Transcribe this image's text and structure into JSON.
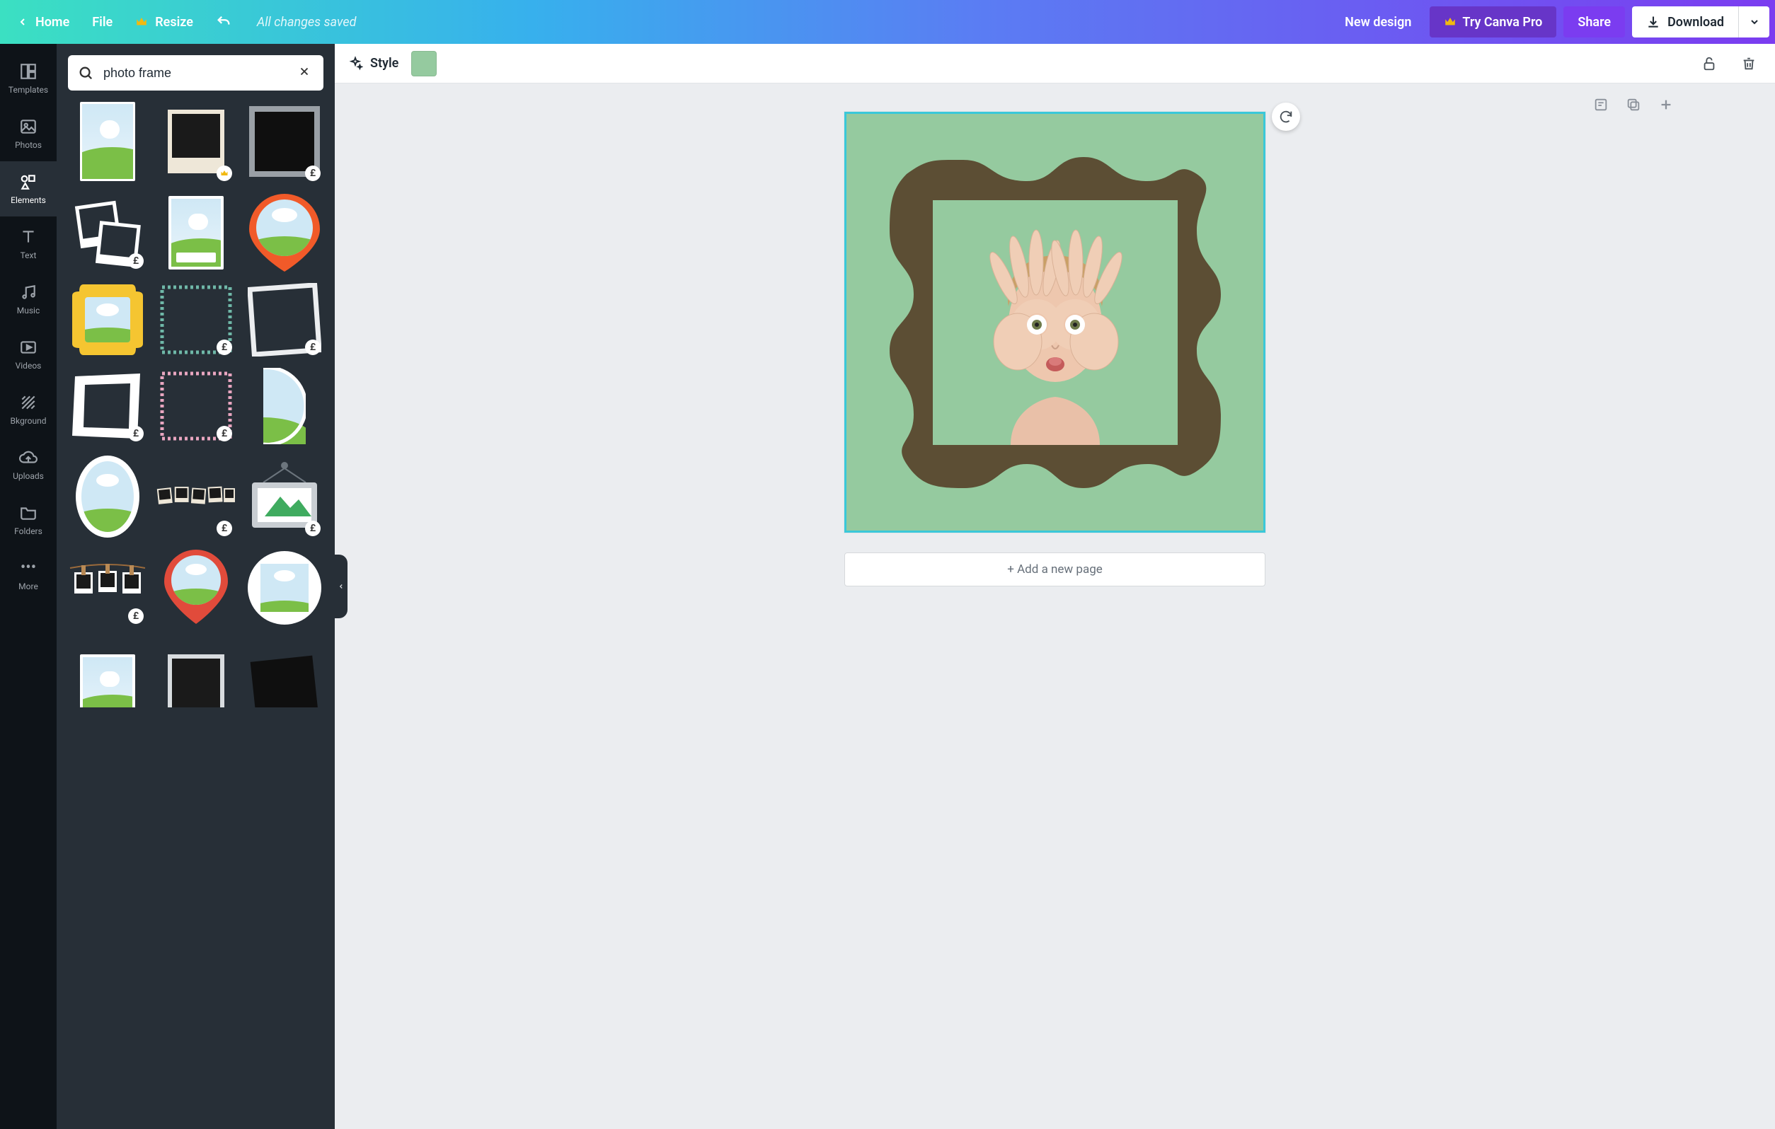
{
  "header": {
    "home": "Home",
    "file": "File",
    "resize": "Resize",
    "saved_status": "All changes saved",
    "new_design": "New design",
    "try_pro": "Try Canva Pro",
    "share": "Share",
    "download": "Download"
  },
  "rail": {
    "templates": "Templates",
    "photos": "Photos",
    "elements": "Elements",
    "text": "Text",
    "music": "Music",
    "videos": "Videos",
    "bkground": "Bkground",
    "uploads": "Uploads",
    "folders": "Folders",
    "more": "More"
  },
  "search": {
    "value": "photo frame"
  },
  "toolbar": {
    "style": "Style"
  },
  "colors": {
    "swatch": "#95ca9f",
    "canvas_bg": "#95ca9f",
    "frame": "#5c4e34"
  },
  "price_badge": "£",
  "add_page_label": "+ Add a new page",
  "results": [
    {
      "name": "portrait-landscape",
      "badge": null
    },
    {
      "name": "polaroid-cream",
      "badge": "crown"
    },
    {
      "name": "square-thick-grey",
      "badge": "price"
    },
    {
      "name": "polaroid-stack",
      "badge": "price"
    },
    {
      "name": "portrait-thin-white",
      "badge": null
    },
    {
      "name": "pin-circle-orange",
      "badge": null
    },
    {
      "name": "ornate-yellow",
      "badge": null
    },
    {
      "name": "stamp-teal",
      "badge": "price"
    },
    {
      "name": "tilted-white",
      "badge": "price"
    },
    {
      "name": "tilted-open-white",
      "badge": "price"
    },
    {
      "name": "stamp-pink",
      "badge": "price"
    },
    {
      "name": "half-circle",
      "badge": null
    },
    {
      "name": "oval-white",
      "badge": null
    },
    {
      "name": "polaroid-string",
      "badge": "price"
    },
    {
      "name": "hanging-grey",
      "badge": "price"
    },
    {
      "name": "clothespin-string",
      "badge": "price"
    },
    {
      "name": "pin-circle-red",
      "badge": null
    },
    {
      "name": "circle-white",
      "badge": null
    },
    {
      "name": "square-thin-white",
      "badge": null
    },
    {
      "name": "square-dark",
      "badge": null
    },
    {
      "name": "tilted-dark",
      "badge": null
    }
  ]
}
